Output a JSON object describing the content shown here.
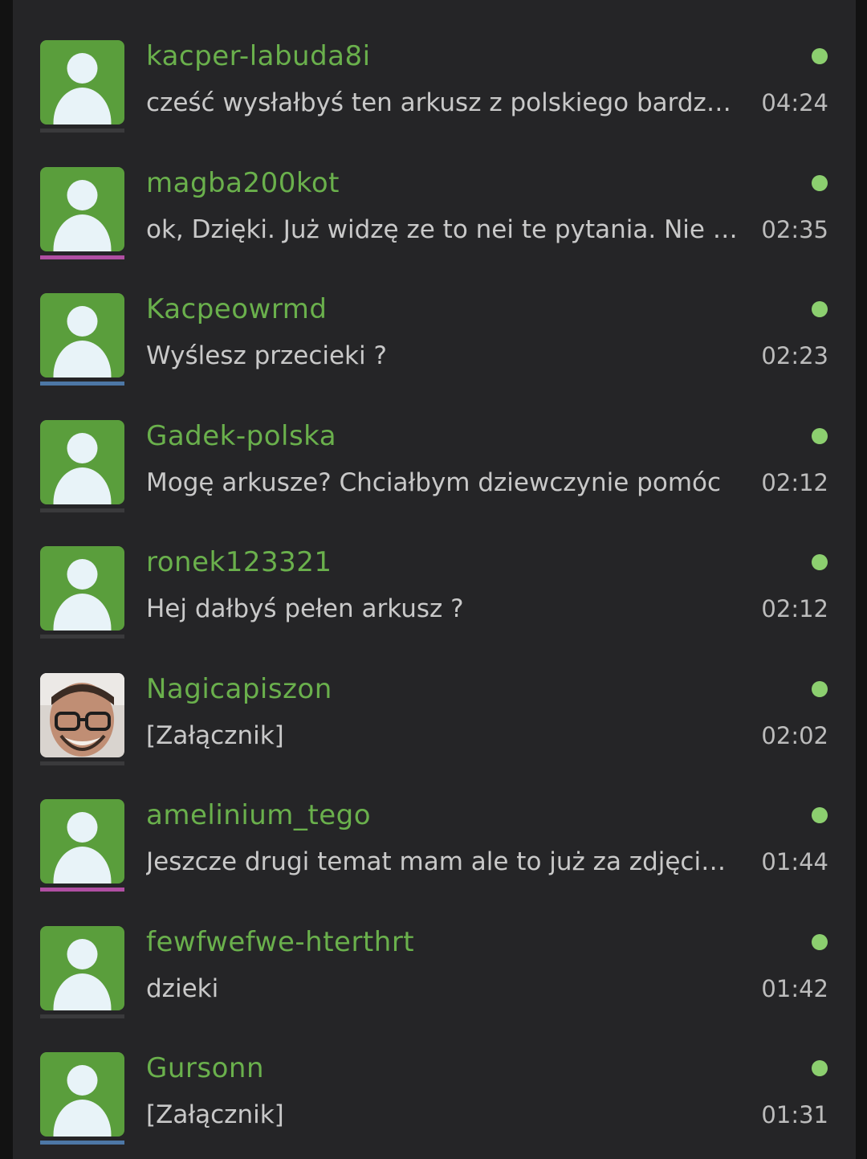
{
  "colors": {
    "background": "#252527",
    "username": "#6ab04c",
    "preview": "#c9c9c9",
    "time": "#bcbcbc",
    "online": "#8ccf6f",
    "avatar_bg": "#5a9e3c",
    "avatar_figure": "#e8f3f8",
    "rank_gray": "#3a3a3c",
    "rank_purple": "#b04fa3",
    "rank_blue": "#4d77a6"
  },
  "conversations": [
    {
      "username": "kacper-labuda8i",
      "preview": "cześć wysłałbyś ten arkusz z polskiego bardzo proszę",
      "time": "04:24",
      "avatar": "default-avatar-icon",
      "rank_color": "#3a3a3c",
      "online": true
    },
    {
      "username": "magba200kot",
      "preview": "ok, Dzięki. Już widzę ze to nei te pytania. Nie wiem",
      "time": "02:35",
      "avatar": "default-avatar-icon",
      "rank_color": "#b04fa3",
      "online": true
    },
    {
      "username": "Kacpeowrmd",
      "preview": "Wyślesz przecieki ?",
      "time": "02:23",
      "avatar": "default-avatar-icon",
      "rank_color": "#4d77a6",
      "online": true
    },
    {
      "username": "Gadek-polska",
      "preview": "Mogę arkusze? Chciałbym dziewczynie pomóc",
      "time": "02:12",
      "avatar": "default-avatar-icon",
      "rank_color": "#3a3a3c",
      "online": true
    },
    {
      "username": "ronek123321",
      "preview": "Hej dałbyś pełen arkusz ?",
      "time": "02:12",
      "avatar": "default-avatar-icon",
      "rank_color": "#3a3a3c",
      "online": true
    },
    {
      "username": "Nagicapiszon",
      "preview": "[Załącznik]",
      "time": "02:02",
      "avatar": "user-photo-avatar",
      "rank_color": "#3a3a3c",
      "online": true
    },
    {
      "username": "amelinium_tego",
      "preview": "Jeszcze drugi temat mam ale to już za zdjęciem",
      "time": "01:44",
      "avatar": "default-avatar-icon",
      "rank_color": "#b04fa3",
      "online": true
    },
    {
      "username": "fewfwefwe-hterthrt",
      "preview": "dzieki",
      "time": "01:42",
      "avatar": "default-avatar-icon",
      "rank_color": "#3a3a3c",
      "online": true
    },
    {
      "username": "Gursonn",
      "preview": "[Załącznik]",
      "time": "01:31",
      "avatar": "default-avatar-icon",
      "rank_color": "#4d77a6",
      "online": true
    }
  ]
}
